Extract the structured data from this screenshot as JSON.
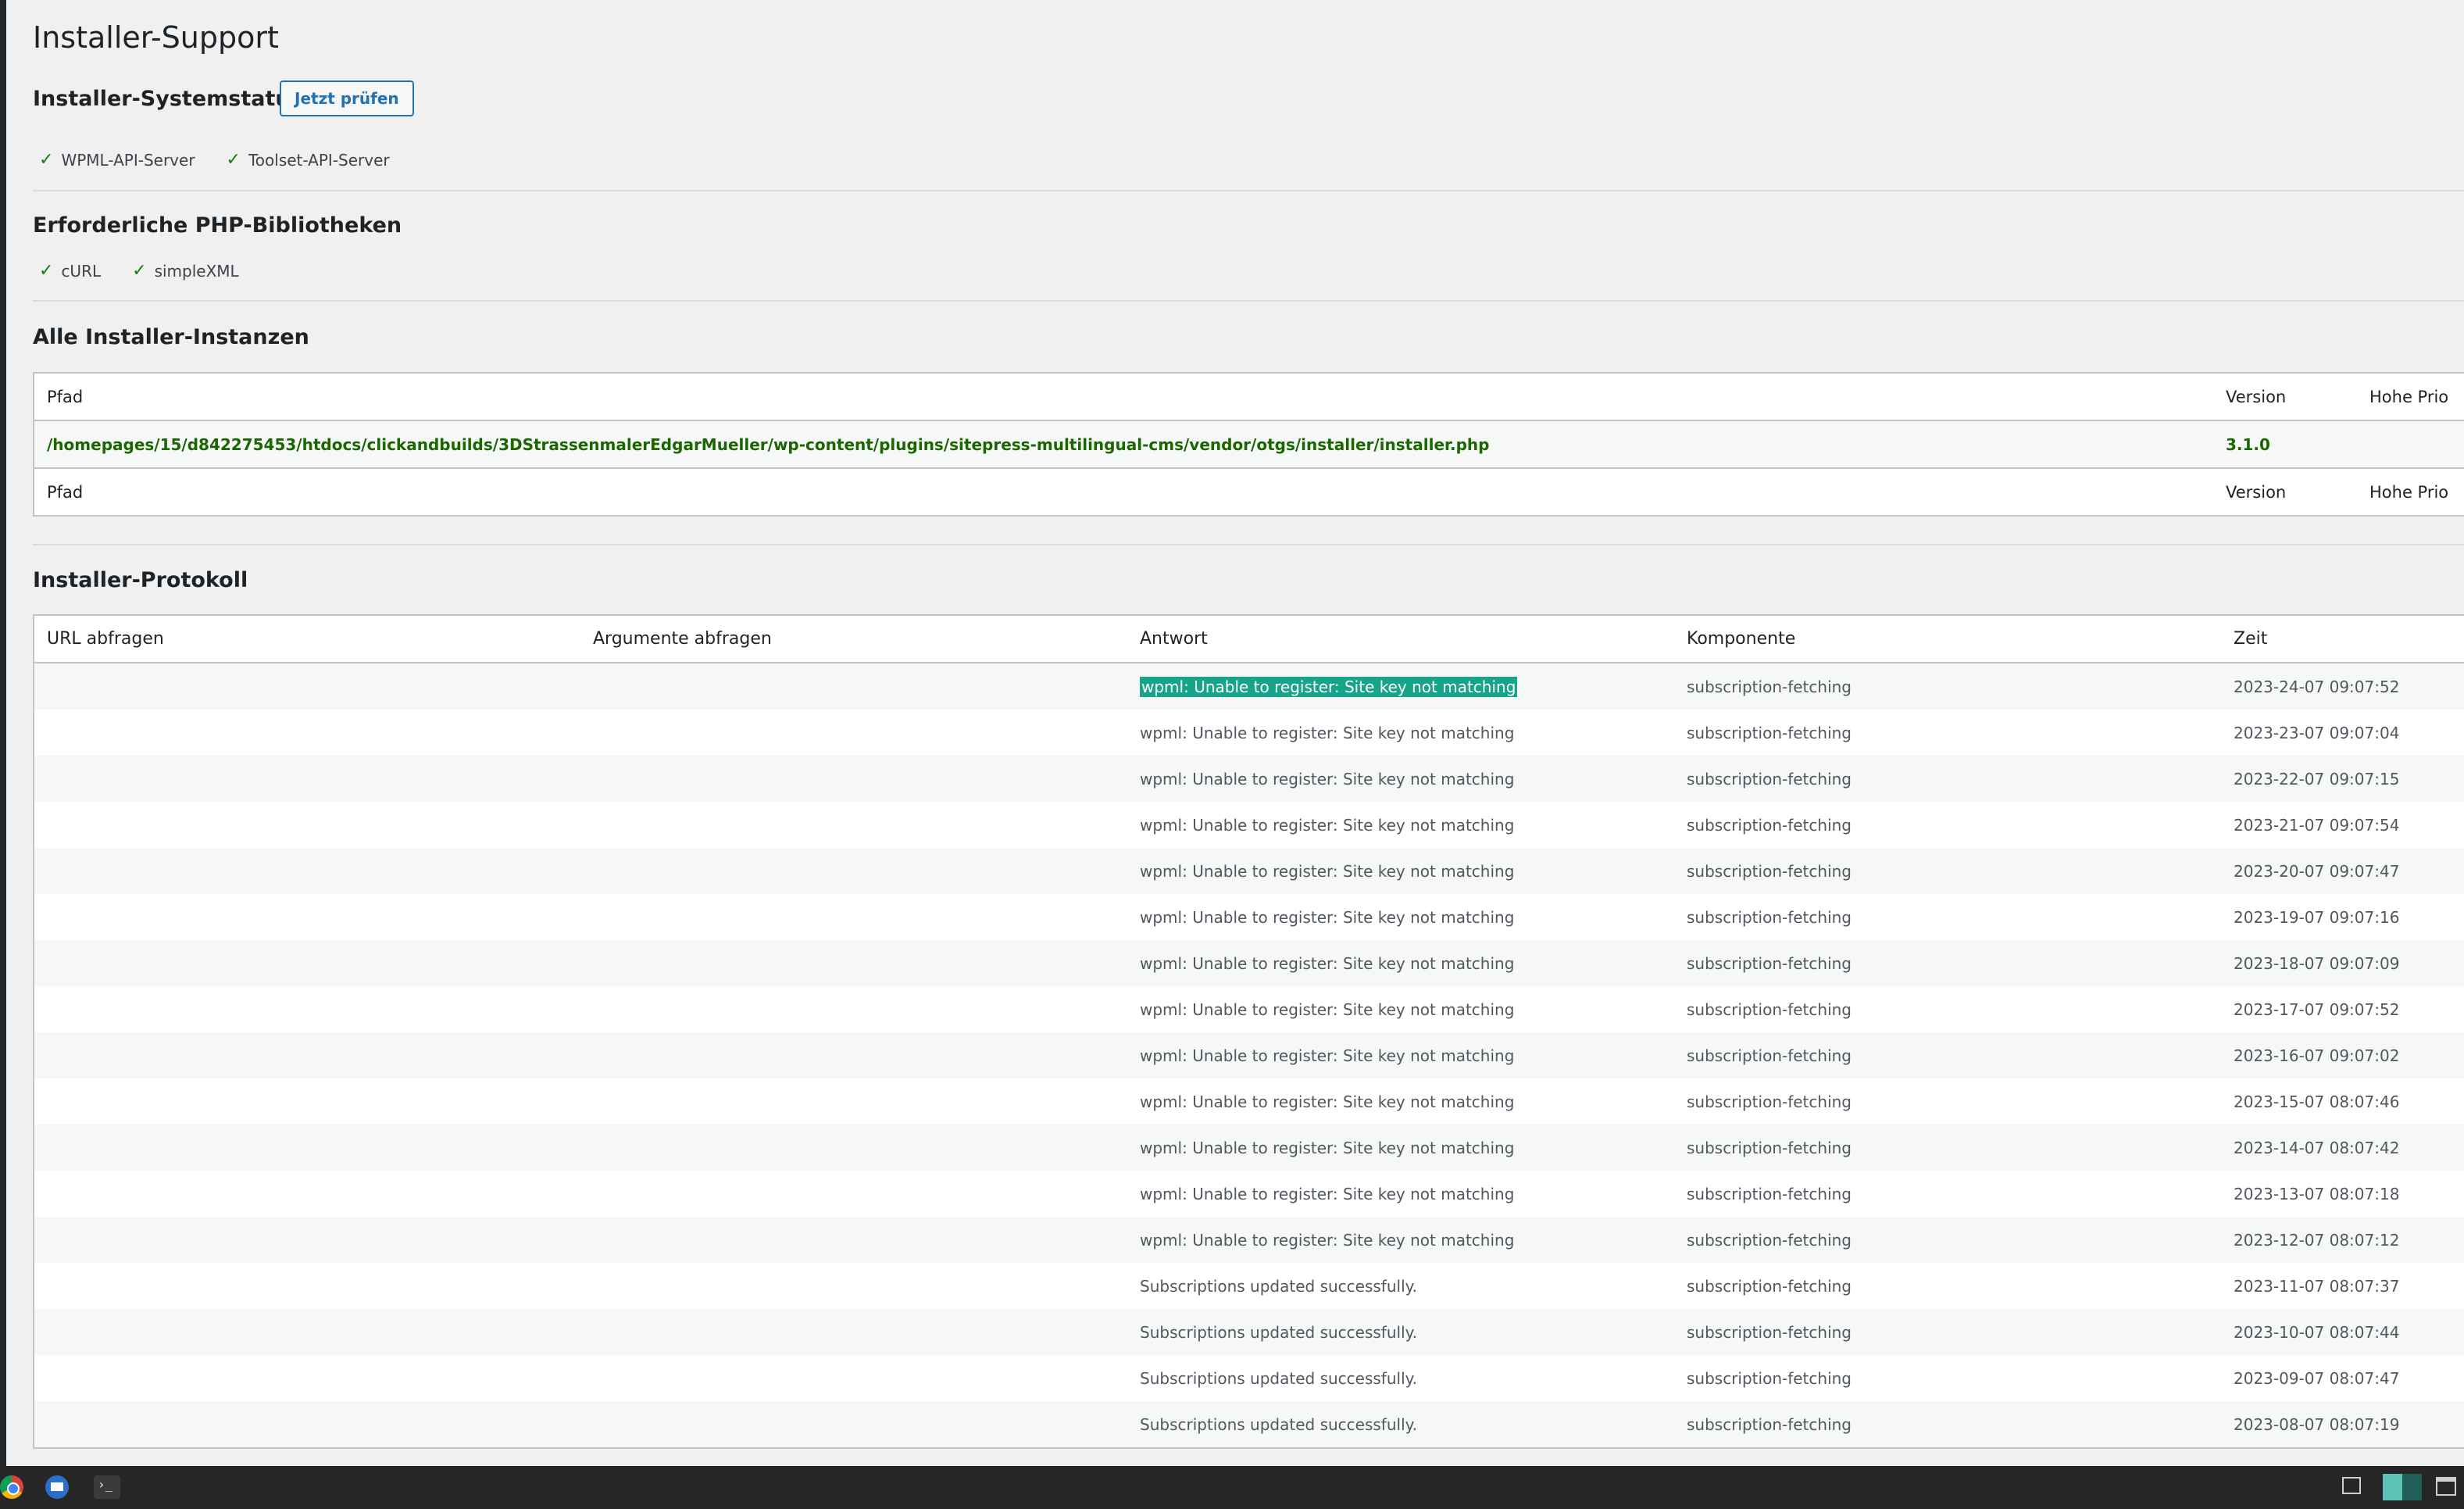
{
  "page_title": "Installer-Support",
  "system_status": {
    "heading": "Installer-Systemstatus",
    "check_button": "Jetzt prüfen",
    "items": [
      "WPML-API-Server",
      "Toolset-API-Server"
    ]
  },
  "php_libs": {
    "heading": "Erforderliche PHP-Bibliotheken",
    "items": [
      "cURL",
      "simpleXML"
    ]
  },
  "instances": {
    "heading": "Alle Installer-Instanzen",
    "columns": [
      "Pfad",
      "Version",
      "Hohe Prio"
    ],
    "row": {
      "path": "/homepages/15/d842275453/htdocs/clickandbuilds/3DStrassenmalerEdgarMueller/wp-content/plugins/sitepress-multilingual-cms/vendor/otgs/installer/installer.php",
      "version": "3.1.0",
      "priority": ""
    },
    "footer": [
      "Pfad",
      "Version",
      "Hohe Prio"
    ]
  },
  "log": {
    "heading": "Installer-Protokoll",
    "columns": [
      "URL abfragen",
      "Argumente abfragen",
      "Antwort",
      "Komponente",
      "Zeit"
    ],
    "rows": [
      {
        "url": "",
        "args": "",
        "response": "wpml: Unable to register: Site key not matching",
        "component": "subscription-fetching",
        "time": "2023-24-07 09:07:52"
      },
      {
        "url": "",
        "args": "",
        "response": "wpml: Unable to register: Site key not matching",
        "component": "subscription-fetching",
        "time": "2023-23-07 09:07:04"
      },
      {
        "url": "",
        "args": "",
        "response": "wpml: Unable to register: Site key not matching",
        "component": "subscription-fetching",
        "time": "2023-22-07 09:07:15"
      },
      {
        "url": "",
        "args": "",
        "response": "wpml: Unable to register: Site key not matching",
        "component": "subscription-fetching",
        "time": "2023-21-07 09:07:54"
      },
      {
        "url": "",
        "args": "",
        "response": "wpml: Unable to register: Site key not matching",
        "component": "subscription-fetching",
        "time": "2023-20-07 09:07:47"
      },
      {
        "url": "",
        "args": "",
        "response": "wpml: Unable to register: Site key not matching",
        "component": "subscription-fetching",
        "time": "2023-19-07 09:07:16"
      },
      {
        "url": "",
        "args": "",
        "response": "wpml: Unable to register: Site key not matching",
        "component": "subscription-fetching",
        "time": "2023-18-07 09:07:09"
      },
      {
        "url": "",
        "args": "",
        "response": "wpml: Unable to register: Site key not matching",
        "component": "subscription-fetching",
        "time": "2023-17-07 09:07:52"
      },
      {
        "url": "",
        "args": "",
        "response": "wpml: Unable to register: Site key not matching",
        "component": "subscription-fetching",
        "time": "2023-16-07 09:07:02"
      },
      {
        "url": "",
        "args": "",
        "response": "wpml: Unable to register: Site key not matching",
        "component": "subscription-fetching",
        "time": "2023-15-07 08:07:46"
      },
      {
        "url": "",
        "args": "",
        "response": "wpml: Unable to register: Site key not matching",
        "component": "subscription-fetching",
        "time": "2023-14-07 08:07:42"
      },
      {
        "url": "",
        "args": "",
        "response": "wpml: Unable to register: Site key not matching",
        "component": "subscription-fetching",
        "time": "2023-13-07 08:07:18"
      },
      {
        "url": "",
        "args": "",
        "response": "wpml: Unable to register: Site key not matching",
        "component": "subscription-fetching",
        "time": "2023-12-07 08:07:12"
      },
      {
        "url": "",
        "args": "",
        "response": "Subscriptions updated successfully.",
        "component": "subscription-fetching",
        "time": "2023-11-07 08:07:37"
      },
      {
        "url": "",
        "args": "",
        "response": "Subscriptions updated successfully.",
        "component": "subscription-fetching",
        "time": "2023-10-07 08:07:44"
      },
      {
        "url": "",
        "args": "",
        "response": "Subscriptions updated successfully.",
        "component": "subscription-fetching",
        "time": "2023-09-07 08:07:47"
      },
      {
        "url": "",
        "args": "",
        "response": "Subscriptions updated successfully.",
        "component": "subscription-fetching",
        "time": "2023-08-07 08:07:19"
      }
    ]
  },
  "colors": {
    "accent": "#2271b1",
    "success": "#1a7a1a",
    "selection": "#17a589",
    "taskbar": "#262626"
  },
  "taskbar": {
    "apps": [
      "chrome-icon",
      "mail-icon",
      "terminal-icon"
    ],
    "tray": [
      "show-desktop-icon",
      "workspace-switcher",
      "calendar-icon"
    ]
  }
}
